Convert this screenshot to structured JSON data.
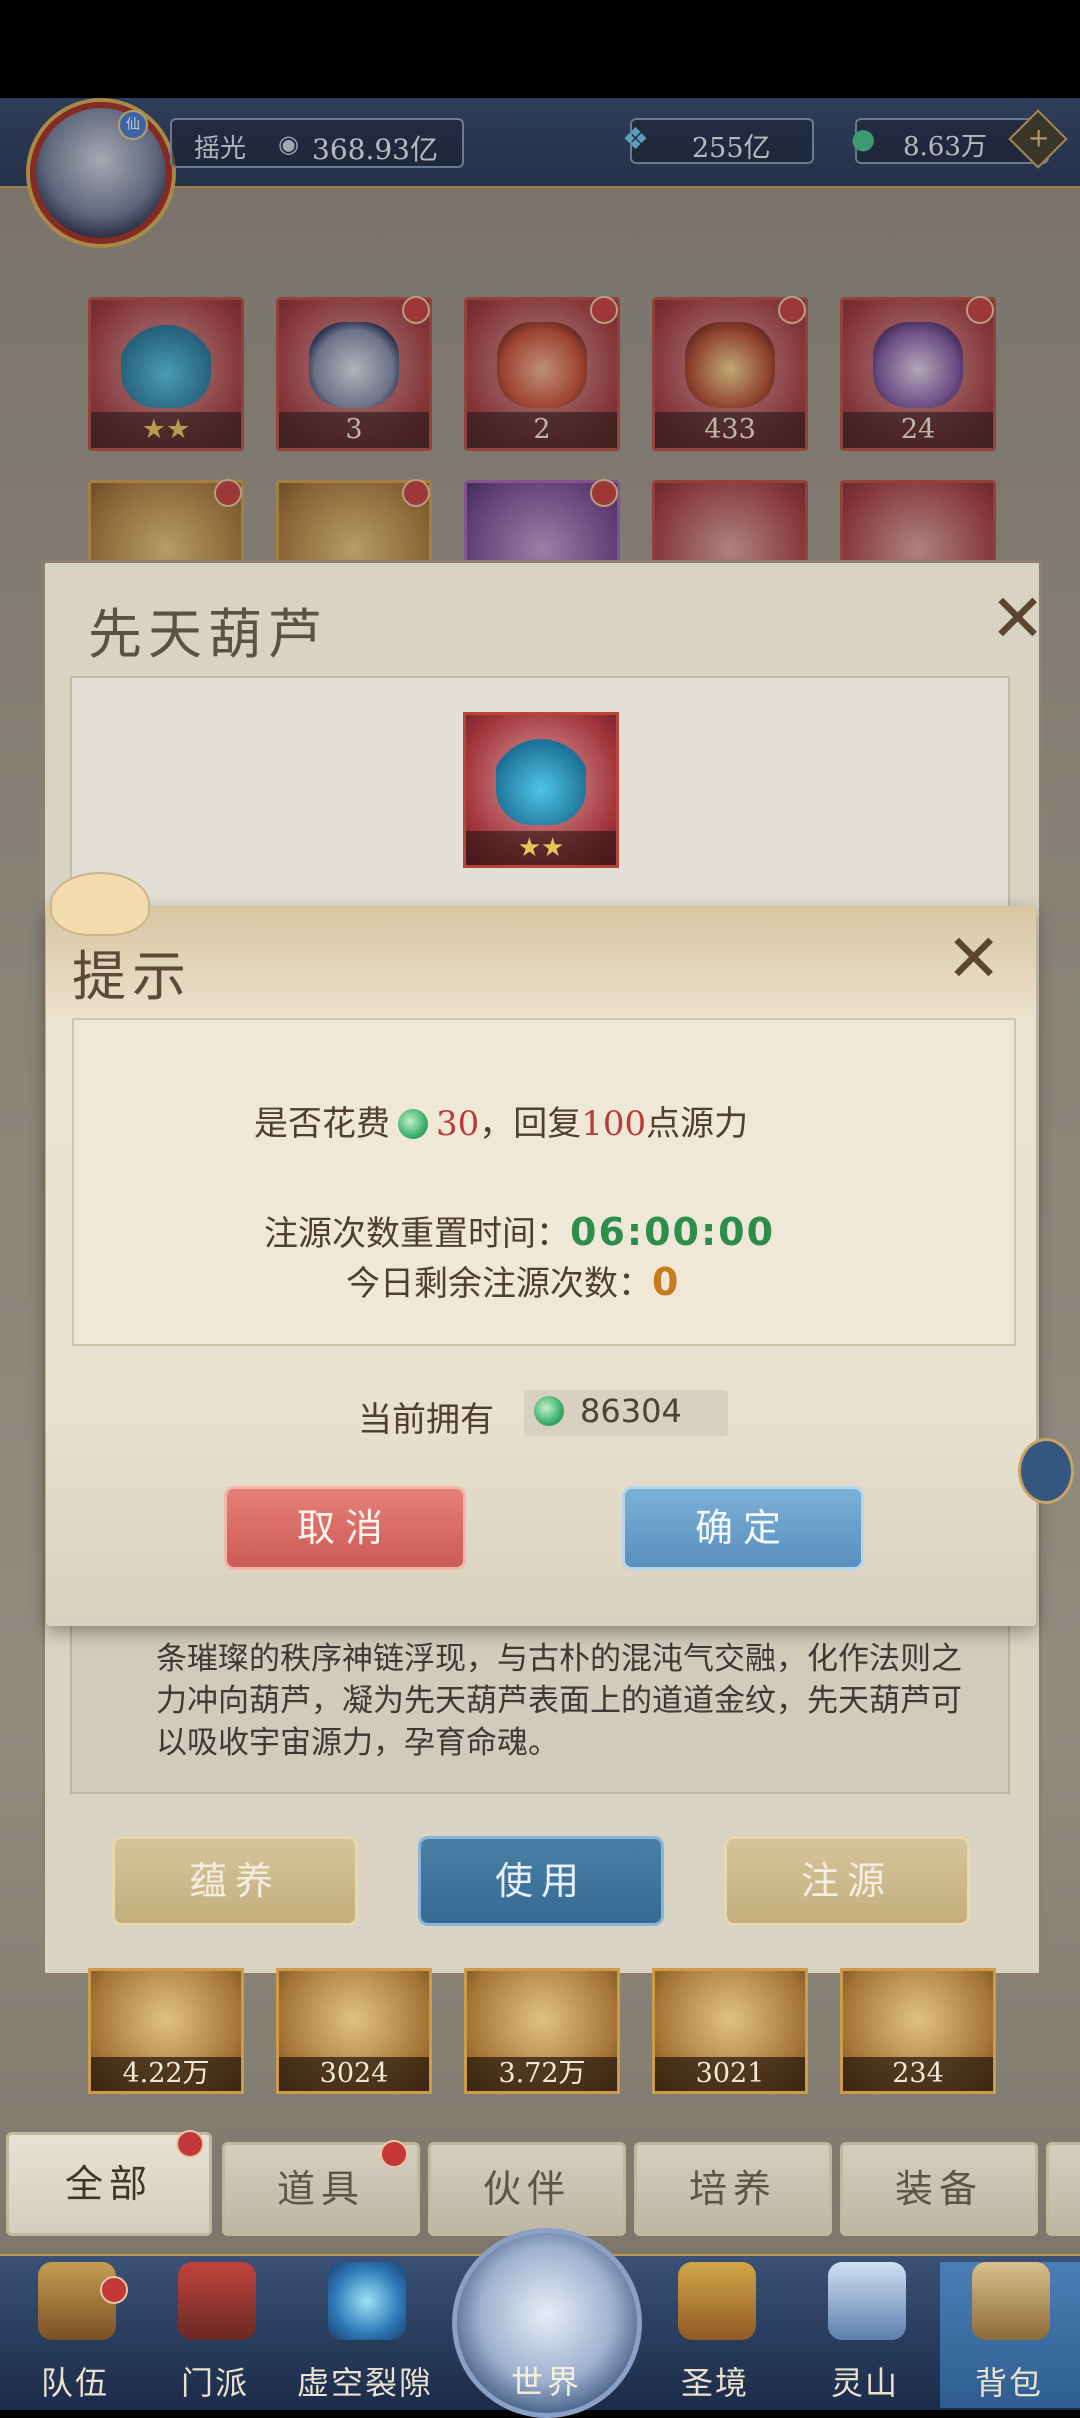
{
  "header": {
    "player_name": "摇光",
    "power_icon": "eye-slash-icon",
    "power_value": "368.93亿",
    "resource1_icon": "blue-crystal-icon",
    "resource1_value": "255亿",
    "resource2_icon": "jade-coin-icon",
    "resource2_value": "8.63万",
    "add_icon": "plus-diamond-icon"
  },
  "grid_row1": [
    {
      "name": "gourd",
      "count": "★★"
    },
    {
      "name": "money-bag",
      "count": "3"
    },
    {
      "name": "red-giftbox",
      "count": "2"
    },
    {
      "name": "treasure-chest",
      "count": "433"
    },
    {
      "name": "taiji-bag",
      "count": "24"
    }
  ],
  "grid_bottom": [
    {
      "name": "black-spike",
      "count": "4.22万"
    },
    {
      "name": "gold-flower",
      "count": "3024"
    },
    {
      "name": "gold-drop",
      "count": "3.72万"
    },
    {
      "name": "blue-flame",
      "count": "3021"
    },
    {
      "name": "silver-ore",
      "count": "234"
    }
  ],
  "item_panel": {
    "title": "先天葫芦",
    "description": "条璀璨的秩序神链浮现，与古朴的混沌气交融，化作法则之力冲向葫芦，凝为先天葫芦表面上的道道金纹，先天葫芦可以吸收宇宙源力，孕育命魂。",
    "buttons": {
      "nurture": "蕴养",
      "use": "使用",
      "inject": "注源"
    }
  },
  "dialog": {
    "title": "提示",
    "line1_pre": "是否花费",
    "line1_cost": "30",
    "line1_mid": "，回复",
    "line1_amount": "100",
    "line1_post": "点源力",
    "reset_label": "注源次数重置时间：",
    "reset_time": "06:00:00",
    "remaining_label": "今日剩余注源次数：",
    "remaining_count": "0",
    "owned_label": "当前拥有",
    "owned_value": "86304",
    "cancel": "取消",
    "confirm": "确定"
  },
  "tabs": [
    "全部",
    "道具",
    "伙伴",
    "培养",
    "装备"
  ],
  "nav": [
    "队伍",
    "门派",
    "虚空裂隙",
    "世界",
    "圣境",
    "灵山",
    "背包"
  ],
  "colors": {
    "red": "#b73c3c",
    "green": "#2d8d4a",
    "orange": "#c77b1d",
    "navy": "#1d2f52"
  }
}
